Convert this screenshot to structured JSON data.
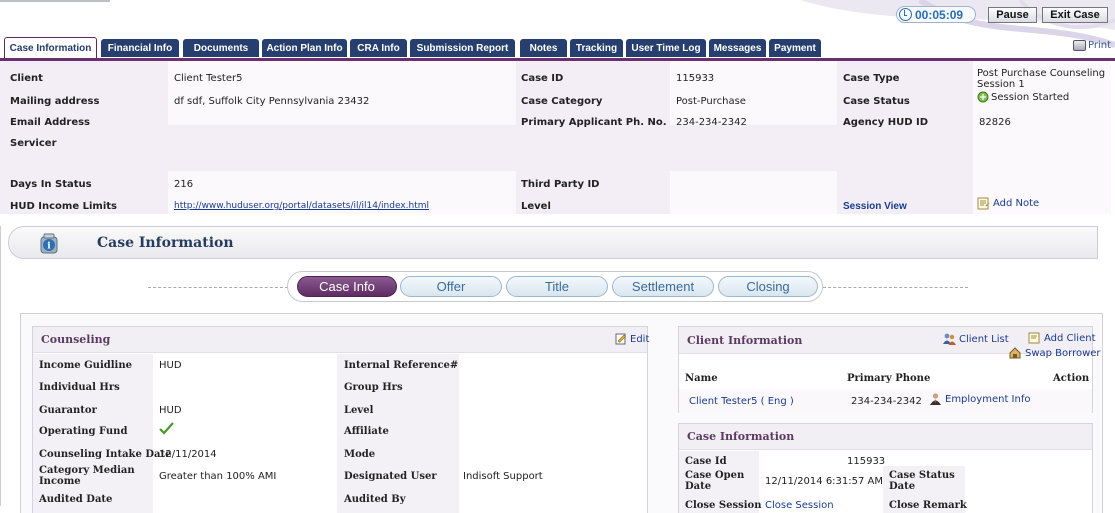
{
  "topbar": {
    "timer": "00:05:09",
    "pause_label": "Pause",
    "exit_label": "Exit Case"
  },
  "tabs": [
    {
      "label": "Case Information",
      "active": true
    },
    {
      "label": "Financial Info"
    },
    {
      "label": "Documents"
    },
    {
      "label": "Action Plan Info"
    },
    {
      "label": "CRA Info"
    },
    {
      "label": "Submission Report"
    },
    {
      "label": "Notes"
    },
    {
      "label": "Tracking"
    },
    {
      "label": "User Time Log"
    },
    {
      "label": "Messages"
    },
    {
      "label": "Payment"
    }
  ],
  "print_label": "Print",
  "header": {
    "client_label": "Client",
    "client_value": "Client Tester5",
    "mailing_label": "Mailing address",
    "mailing_value": "df sdf, Suffolk City Pennsylvania 23432",
    "email_label": "Email Address",
    "servicer_label": "Servicer",
    "days_label": "Days In Status",
    "days_value": "216",
    "hud_label": "HUD Income Limits",
    "hud_value": "http://www.huduser.org/portal/datasets/il/il14/index.html",
    "caseid_label": "Case ID",
    "caseid_value": "115933",
    "category_label": "Case Category",
    "category_value": "Post-Purchase",
    "phone_label": "Primary Applicant Ph. No.",
    "phone_value": "234-234-2342",
    "thirdparty_label": "Third Party ID",
    "level_label": "Level",
    "casetype_label": "Case Type",
    "casetype_value_1": "Post Purchase Counseling",
    "casetype_value_2": "Session 1",
    "status_label": "Case Status",
    "status_value": "Session Started",
    "agency_label": "Agency HUD ID",
    "agency_value": "82826",
    "session_view": "Session View",
    "add_note": "Add Note"
  },
  "section": {
    "title": "Case Information"
  },
  "steps": [
    {
      "label": "Case Info",
      "active": true
    },
    {
      "label": "Offer"
    },
    {
      "label": "Title"
    },
    {
      "label": "Settlement"
    },
    {
      "label": "Closing"
    }
  ],
  "counseling": {
    "title": "Counseling",
    "edit": "Edit",
    "income_label": "Income Guidline",
    "income_value": "HUD",
    "internal_label": "Internal Reference#",
    "indhrs_label": "Individual Hrs",
    "grouphrs_label": "Group Hrs",
    "guarantor_label": "Guarantor",
    "guarantor_value": "HUD",
    "level_label": "Level",
    "fund_label": "Operating Fund",
    "affiliate_label": "Affiliate",
    "intake_label": "Counseling Intake Date",
    "intake_value": "12/11/2014",
    "mode_label": "Mode",
    "median_label_1": "Category Median",
    "median_label_2": "Income",
    "median_value": "Greater than 100% AMI",
    "designated_label": "Designated User",
    "designated_value": "Indisoft Support",
    "audited_date_label": "Audited Date",
    "audited_by_label": "Audited By"
  },
  "client_info": {
    "title": "Client Information",
    "client_list": "Client List",
    "add_client": "Add Client",
    "swap": "Swap Borrower",
    "col_name": "Name",
    "col_phone": "Primary Phone",
    "col_action": "Action",
    "row_name": "Client Tester5 ( Eng )",
    "row_phone": "234-234-2342",
    "row_action": "Employment Info"
  },
  "case_info": {
    "title": "Case Information",
    "id_label": "Case Id",
    "id_value": "115933",
    "open_label_1": "Case Open",
    "open_label_2": "Date",
    "open_value": "12/11/2014 6:31:57 AM",
    "status_label_1": "Case Status",
    "status_label_2": "Date",
    "close_session_label": "Close Session",
    "close_session_value": "Close Session",
    "close_remark_label": "Close Remark"
  },
  "colors": {
    "tab_bg": "#263f6e",
    "accent_purple": "#6b2e6e",
    "link": "#1a3b8f"
  }
}
